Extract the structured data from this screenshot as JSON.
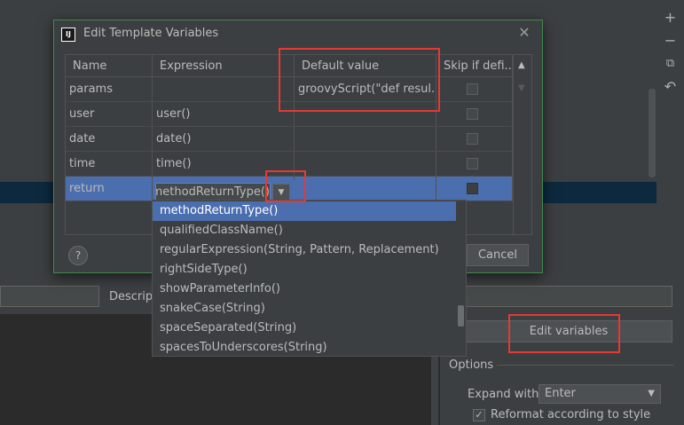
{
  "dialog": {
    "title": "Edit Template Variables",
    "icon_text": "IJ",
    "close_glyph": "✕",
    "help_glyph": "?",
    "cancel_label": "Cancel"
  },
  "table": {
    "columns": [
      "Name",
      "Expression",
      "Default value",
      "Skip if defi..."
    ],
    "rows": [
      {
        "name": "params",
        "expression": "",
        "default": "groovyScript(\"def resul...",
        "skip": false
      },
      {
        "name": "user",
        "expression": "user()",
        "default": "",
        "skip": false
      },
      {
        "name": "date",
        "expression": "date()",
        "default": "",
        "skip": false
      },
      {
        "name": "time",
        "expression": "time()",
        "default": "",
        "skip": false
      },
      {
        "name": "return",
        "expression": "methodReturnType()",
        "default": "",
        "skip": false
      }
    ],
    "editing_value": "methodReturnType()",
    "scroll_up": "▲",
    "scroll_down": "▼",
    "dropdown_glyph": "▼"
  },
  "popup": {
    "items": [
      "methodReturnType()",
      "qualifiedClassName()",
      "regularExpression(String, Pattern, Replacement)",
      "rightSideType()",
      "showParameterInfo()",
      "snakeCase(String)",
      "spaceSeparated(String)",
      "spacesToUnderscores(String)"
    ],
    "selected_index": 0
  },
  "background": {
    "description_label": "Descript",
    "edit_variables_label": "Edit variables",
    "options_label": "Options",
    "expand_with_label": "Expand with",
    "expand_with_value": "Enter",
    "reformat_label": "Reformat according to style",
    "reformat_checked": true,
    "check_glyph": "✓",
    "chevron_glyph": "▼",
    "toolbar": {
      "add": "+",
      "remove": "−",
      "copy": "⧉",
      "undo": "↶"
    }
  },
  "colors": {
    "selection": "#4b6eaf",
    "annotation_red": "#e53935",
    "dialog_border": "#3f8a4a"
  }
}
